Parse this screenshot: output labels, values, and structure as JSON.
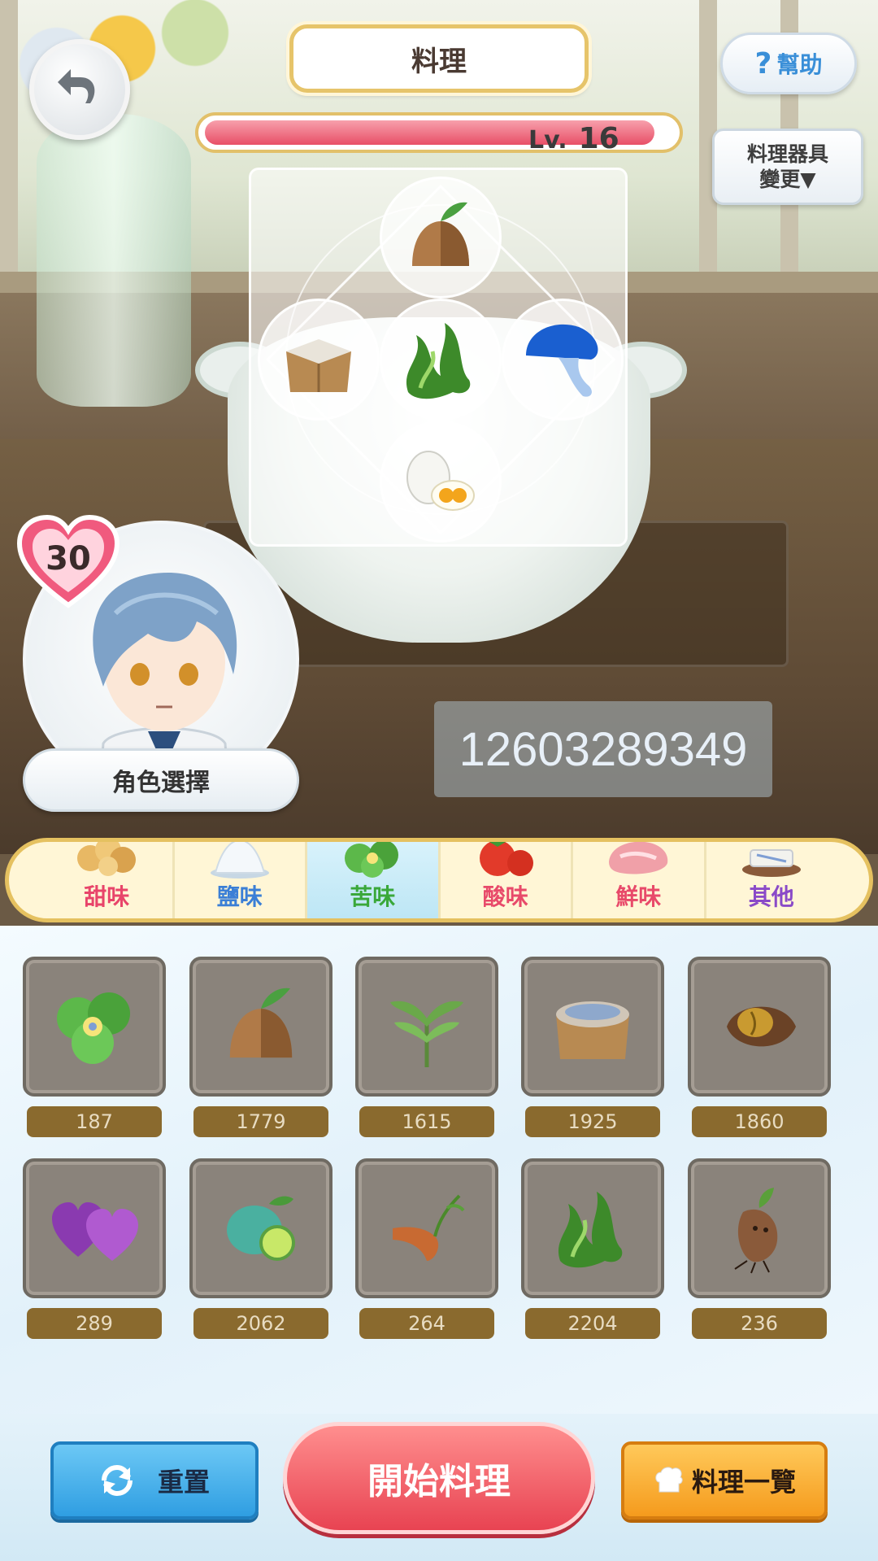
{
  "header": {
    "title": "料理",
    "help_label": "幫助",
    "help_icon": "?",
    "level_prefix": "Lv.",
    "level_value": "16",
    "level_progress": 0.96,
    "utensil_line1": "料理器具",
    "utensil_line2": "變更▼"
  },
  "recipe_slots": [
    "chestnut",
    "rice-box",
    "seaweed",
    "blue-mushroom",
    "eggs"
  ],
  "character": {
    "affection": "30",
    "select_label": "角色選擇"
  },
  "overlay_id": "12603289349",
  "tabs": [
    {
      "label": "甜味",
      "color": "#e8446a",
      "icon": "nuts-icon"
    },
    {
      "label": "鹽味",
      "color": "#3b7fd6",
      "icon": "salt-icon"
    },
    {
      "label": "苦味",
      "color": "#3aa83a",
      "icon": "bitter-herb-icon",
      "active": true
    },
    {
      "label": "酸味",
      "color": "#e84a6a",
      "icon": "tomato-icon"
    },
    {
      "label": "鮮味",
      "color": "#e84a6a",
      "icon": "meat-icon"
    },
    {
      "label": "其他",
      "color": "#8a4ac8",
      "icon": "other-icon"
    }
  ],
  "items": [
    {
      "name": "green-flower",
      "count": "187"
    },
    {
      "name": "chestnut",
      "count": "1779"
    },
    {
      "name": "herb-leaves",
      "count": "1615"
    },
    {
      "name": "rice-sack",
      "count": "1925"
    },
    {
      "name": "coffee-bean",
      "count": "1860"
    },
    {
      "name": "purple-heart-fruit",
      "count": "289"
    },
    {
      "name": "lime",
      "count": "2062"
    },
    {
      "name": "burdock-root",
      "count": "264"
    },
    {
      "name": "seaweed",
      "count": "2204"
    },
    {
      "name": "mandrake",
      "count": "236"
    }
  ],
  "buttons": {
    "reset": "重置",
    "start": "開始料理",
    "list": "料理一覽"
  }
}
